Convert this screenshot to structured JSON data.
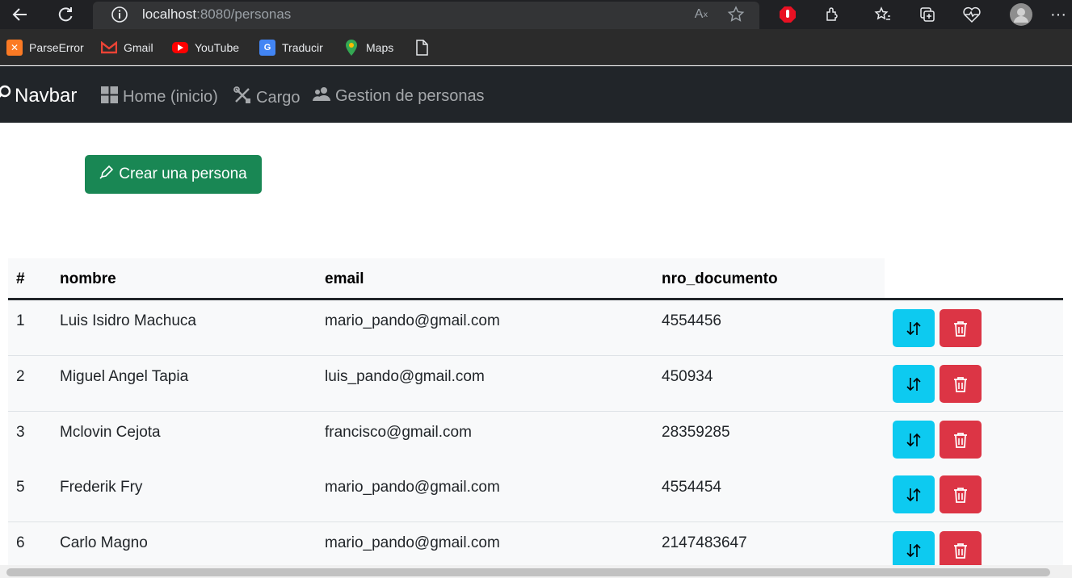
{
  "browser": {
    "url_host": "localhost",
    "url_path": ":8080/personas",
    "bookmarks": [
      {
        "label": "ParseError",
        "icon": "xampp-icon",
        "color": "#fb7a24"
      },
      {
        "label": "Gmail",
        "icon": "gmail-icon",
        "color": "#ea4335"
      },
      {
        "label": "YouTube",
        "icon": "youtube-icon",
        "color": "#ff0000"
      },
      {
        "label": "Traducir",
        "icon": "translate-icon",
        "color": "#4285f4"
      },
      {
        "label": "Maps",
        "icon": "maps-icon",
        "color": "#34a853"
      }
    ]
  },
  "navbar": {
    "brand": "Navbar",
    "links": [
      {
        "label": "Home (inicio)",
        "icon": "grid-icon"
      },
      {
        "label": "Cargo",
        "icon": "tools-icon"
      },
      {
        "label": "Gestion de personas",
        "icon": "people-icon"
      }
    ]
  },
  "create_button": {
    "label": "Crear una persona",
    "color": "#198754"
  },
  "table": {
    "headers": [
      "#",
      "nombre",
      "email",
      "nro_documento"
    ],
    "rows": [
      {
        "id": "1",
        "nombre": "Luis Isidro Machuca",
        "email": "mario_pando@gmail.com",
        "nro_documento": "4554456"
      },
      {
        "id": "2",
        "nombre": "Miguel Angel Tapia",
        "email": "luis_pando@gmail.com",
        "nro_documento": "450934"
      },
      {
        "id": "3",
        "nombre": "Mclovin Cejota",
        "email": "francisco@gmail.com",
        "nro_documento": "28359285"
      },
      {
        "id": "5",
        "nombre": "Frederik Fry",
        "email": "mario_pando@gmail.com",
        "nro_documento": "4554454"
      },
      {
        "id": "6",
        "nombre": "Carlo Magno",
        "email": "mario_pando@gmail.com",
        "nro_documento": "2147483647"
      }
    ],
    "edit_color": "#0dcaf0",
    "delete_color": "#dc3545"
  }
}
